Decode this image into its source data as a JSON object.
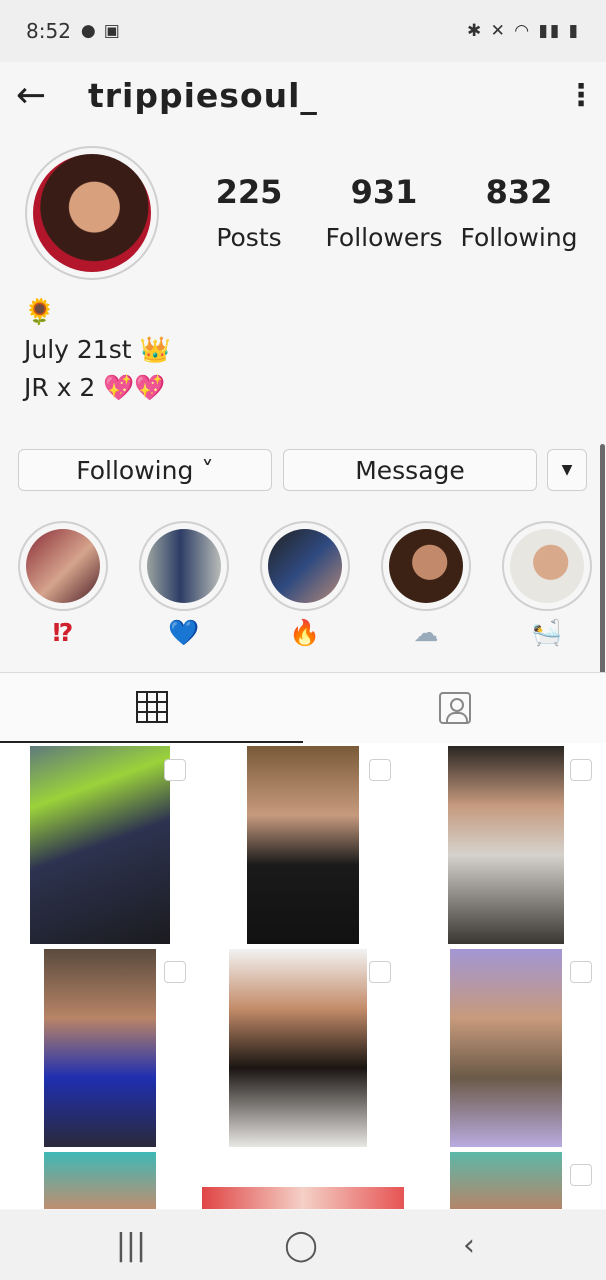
{
  "status_bar": {
    "time": "8:52"
  },
  "header": {
    "username": "trippiesoul_"
  },
  "stats": [
    {
      "value": "225",
      "label": "Posts"
    },
    {
      "value": "931",
      "label": "Followers"
    },
    {
      "value": "832",
      "label": "Following"
    }
  ],
  "bio": {
    "line1": "🌻",
    "line2": "July 21st 👑",
    "line3": "JR x 2 💖💖"
  },
  "buttons": {
    "following": "Following ˅",
    "message": "Message",
    "dropdown": "▼"
  },
  "highlights": [
    {
      "label": "⁉"
    },
    {
      "label": "💙"
    },
    {
      "label": "🔥"
    },
    {
      "label": "☁"
    },
    {
      "label": "🛀"
    }
  ],
  "tabs": {
    "grid": "grid-icon",
    "tagged": "tagged-icon"
  }
}
